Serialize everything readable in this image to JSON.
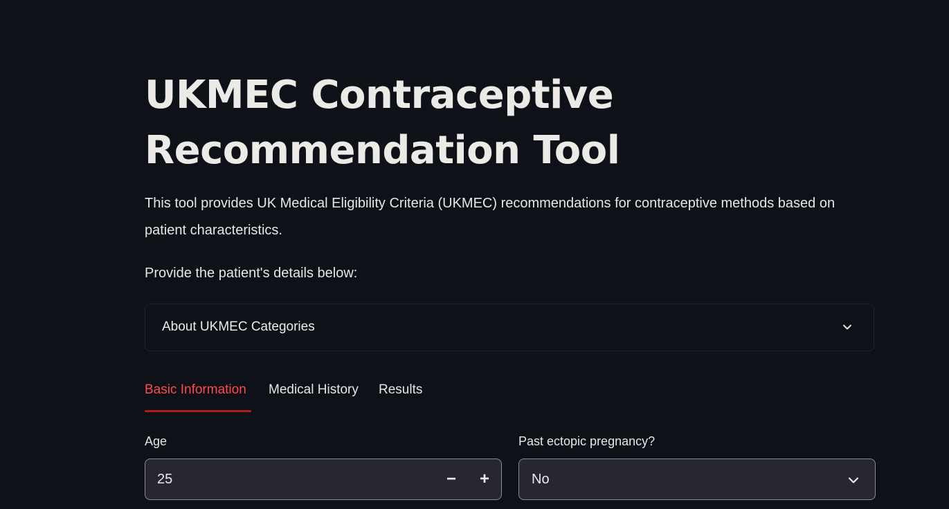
{
  "header": {
    "title": "UKMEC Contraceptive Recommendation Tool"
  },
  "intro": {
    "description": "This tool provides UK Medical Eligibility Criteria (UKMEC) recommendations for contraceptive methods based on patient characteristics.",
    "prompt": "Provide the patient's details below:"
  },
  "expander": {
    "label": "About UKMEC Categories",
    "icon": "chevron-down-icon"
  },
  "tabs": [
    {
      "label": "Basic Information",
      "active": true
    },
    {
      "label": "Medical History",
      "active": false
    },
    {
      "label": "Results",
      "active": false
    }
  ],
  "form": {
    "age": {
      "label": "Age",
      "value": "25",
      "decrement_icon": "minus-icon",
      "decrement_label": "−",
      "increment_icon": "plus-icon",
      "increment_label": "+"
    },
    "ectopic": {
      "label": "Past ectopic pregnancy?",
      "value": "No",
      "icon": "chevron-down-icon"
    }
  },
  "colors": {
    "background": "#0e1117",
    "accent": "#ff4b4b",
    "tab_underline": "#b31b1b",
    "input_bg": "#262730"
  }
}
